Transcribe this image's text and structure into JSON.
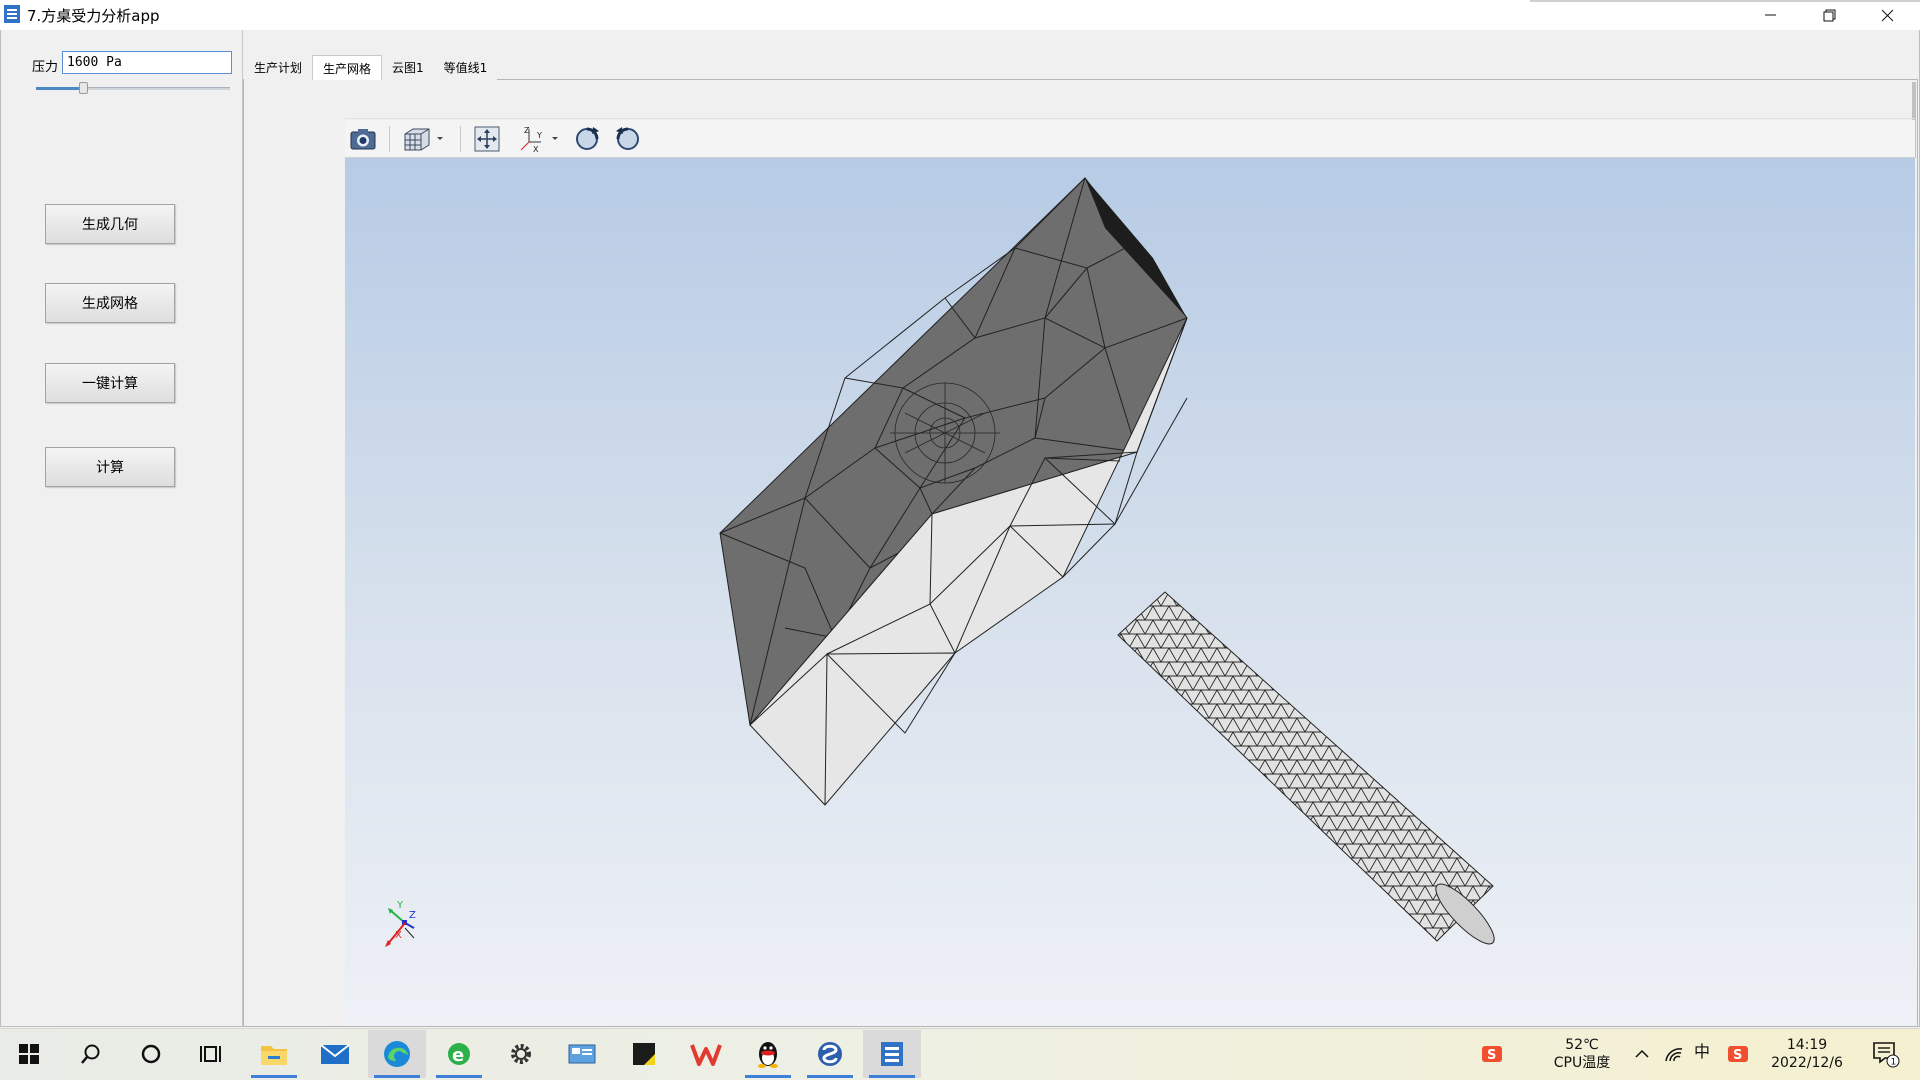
{
  "window": {
    "title": "7.方桌受力分析app"
  },
  "left_panel": {
    "pressure_label": "压力",
    "pressure_value": "1600 Pa",
    "slider_value_fraction": 0.24,
    "buttons": {
      "generate_geometry": "生成几何",
      "generate_mesh": "生成网格",
      "one_click_compute": "一键计算",
      "compute": "计算"
    }
  },
  "tabs": [
    {
      "label": "生产计划"
    },
    {
      "label": "生产网格"
    },
    {
      "label": "云图1"
    },
    {
      "label": "等值线1"
    }
  ],
  "active_tab": 1,
  "toolbar": {
    "icons": [
      "camera-icon",
      "view-cube-icon",
      "zoom-extents-icon",
      "axis-orientation-icon",
      "rotate-left-icon",
      "rotate-right-icon"
    ]
  },
  "viewport": {
    "axis_labels": {
      "x": "X",
      "y": "Y",
      "z": "Z"
    },
    "colors": {
      "mesh_dark": "#6e6e6e",
      "mesh_light": "#e6e6e6",
      "edges": "#1a1a1a"
    }
  },
  "taskbar": {
    "apps": [
      "windows-start-icon",
      "search-icon",
      "cortana-icon",
      "task-view-icon",
      "file-explorer-icon",
      "mail-icon",
      "edge-icon",
      "ie-icon",
      "settings-icon",
      "control-panel-icon",
      "sticky-icon",
      "wps-icon",
      "qq-icon",
      "sogou-icon",
      "app-window-icon"
    ],
    "temperature": "52℃",
    "temperature_label": "CPU温度",
    "input_method": "中",
    "time": "14:19",
    "date": "2022/12/6",
    "notification_count": "1"
  }
}
